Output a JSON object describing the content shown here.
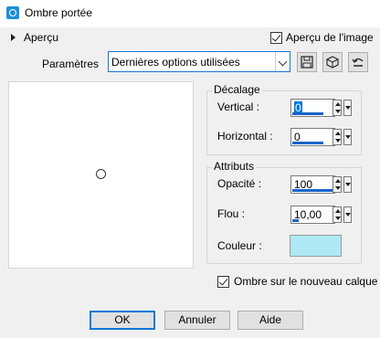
{
  "window": {
    "title": "Ombre portée"
  },
  "preview": {
    "toggle_label": "Aperçu",
    "image_preview_label": "Aperçu de l'image",
    "image_preview_checked": true
  },
  "params": {
    "label": "Paramètres",
    "selected": "Dernières options utilisées"
  },
  "offset": {
    "title": "Décalage",
    "vertical_label": "Vertical :",
    "vertical_value": "0",
    "horizontal_label": "Horizontal :",
    "horizontal_value": "0"
  },
  "attributes": {
    "title": "Attributs",
    "opacity_label": "Opacité :",
    "opacity_value": "100",
    "blur_label": "Flou :",
    "blur_value": "10,00",
    "color_label": "Couleur :",
    "color_value": "#aee9f5"
  },
  "new_layer": {
    "label": "Ombre sur le nouveau calque",
    "checked": true
  },
  "buttons": {
    "ok": "OK",
    "cancel": "Annuler",
    "help": "Aide"
  }
}
